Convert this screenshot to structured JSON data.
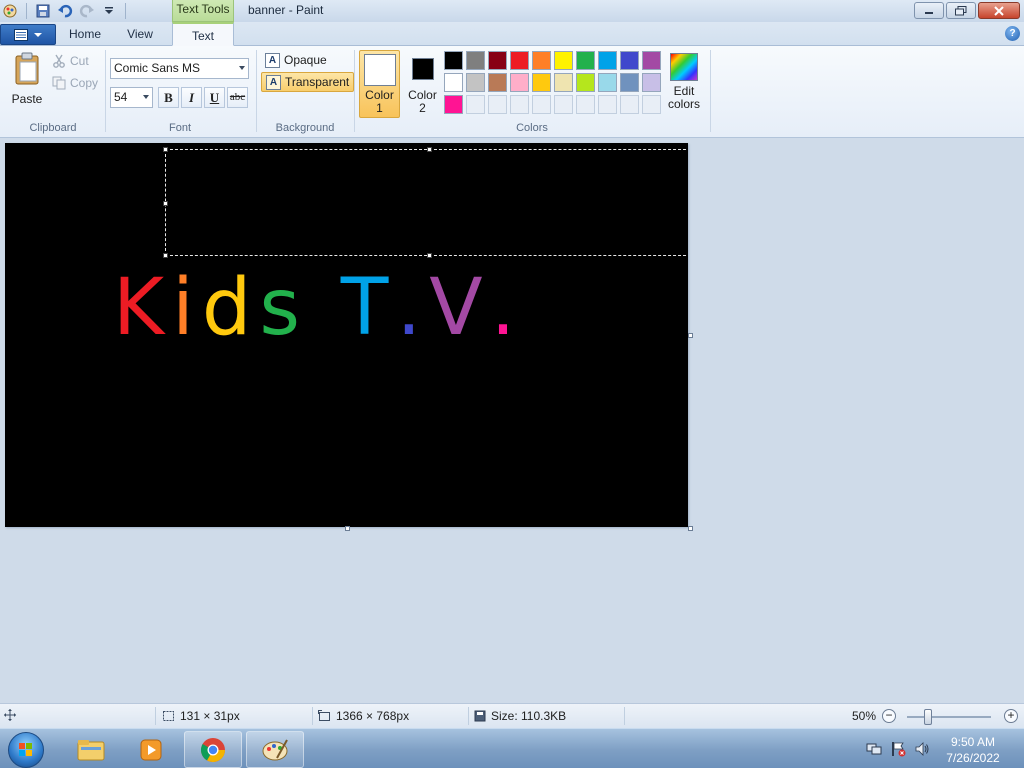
{
  "window": {
    "title": "banner - Paint",
    "context_tab": "Text Tools"
  },
  "tabs": [
    {
      "label": "Home"
    },
    {
      "label": "View"
    },
    {
      "label": "Text"
    }
  ],
  "ribbon": {
    "clipboard": {
      "group_label": "Clipboard",
      "paste": "Paste",
      "cut": "Cut",
      "copy": "Copy"
    },
    "font": {
      "group_label": "Font",
      "family": "Comic Sans MS",
      "size": "54",
      "bold": "B",
      "italic": "I",
      "underline": "U",
      "strike": "abc"
    },
    "background": {
      "group_label": "Background",
      "opaque": "Opaque",
      "transparent": "Transparent",
      "selected": "Transparent"
    },
    "colors": {
      "group_label": "Colors",
      "color1_label": "Color\n1",
      "color1_line1": "Color",
      "color1_line2": "1",
      "color2_line1": "Color",
      "color2_line2": "2",
      "color1_value": "#ffffff",
      "color2_value": "#000000",
      "edit_line1": "Edit",
      "edit_line2": "colors",
      "palette_row1": [
        "#000000",
        "#7f7f7f",
        "#880015",
        "#ed1c24",
        "#ff7f27",
        "#fff200",
        "#22b14c",
        "#00a2e8",
        "#3f48cc",
        "#a349a4"
      ],
      "palette_row2": [
        "#ffffff",
        "#c3c3c3",
        "#b97a57",
        "#ffaec9",
        "#ffc90e",
        "#efe4b0",
        "#b5e61d",
        "#99d9ea",
        "#7092be",
        "#c8bfe7"
      ],
      "palette_row3": [
        "#ff1493",
        "",
        "",
        "",
        "",
        "",
        "",
        "",
        "",
        ""
      ]
    }
  },
  "canvas": {
    "text_letters": [
      {
        "ch": "K",
        "color": "#ed1c24"
      },
      {
        "ch": "i",
        "color": "#ff7f27"
      },
      {
        "ch": "d",
        "color": "#ffc90e"
      },
      {
        "ch": "s",
        "color": "#22b14c"
      },
      {
        "ch": " ",
        "color": "#000000"
      },
      {
        "ch": "T",
        "color": "#00a2e8"
      },
      {
        "ch": ".",
        "color": "#3f48cc"
      },
      {
        "ch": "V",
        "color": "#a349a4"
      },
      {
        "ch": ".",
        "color": "#ff1493"
      }
    ]
  },
  "status": {
    "selection_size": "131 × 31px",
    "image_size": "1366 × 768px",
    "file_size": "Size: 110.3KB",
    "zoom": "50%",
    "zoom_minus": "−",
    "zoom_plus": "+"
  },
  "taskbar": {
    "time": "9:50 AM",
    "date": "7/26/2022"
  }
}
